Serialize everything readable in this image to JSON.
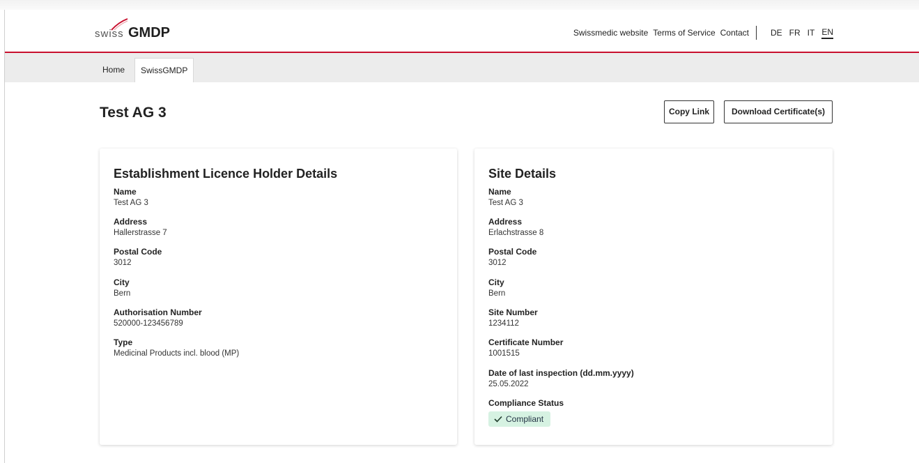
{
  "brand": {
    "logo_prefix": "swiss",
    "logo_main": "GMDP"
  },
  "topnav": {
    "links": [
      "Swissmedic website",
      "Terms of Service",
      "Contact"
    ],
    "languages": [
      "DE",
      "FR",
      "IT",
      "EN"
    ],
    "active_language": "EN"
  },
  "breadcrumb": {
    "home": "Home",
    "current": "SwissGMDP"
  },
  "page": {
    "title": "Test AG 3",
    "copy_link": "Copy Link",
    "download": "Download Certificate(s)"
  },
  "holder": {
    "heading": "Establishment Licence Holder Details",
    "fields": [
      {
        "label": "Name",
        "value": "Test AG 3"
      },
      {
        "label": "Address",
        "value": "Hallerstrasse 7"
      },
      {
        "label": "Postal Code",
        "value": "3012"
      },
      {
        "label": "City",
        "value": "Bern"
      },
      {
        "label": "Authorisation Number",
        "value": "520000-123456789"
      },
      {
        "label": "Type",
        "value": "Medicinal Products incl. blood (MP)"
      }
    ]
  },
  "site": {
    "heading": "Site Details",
    "fields": [
      {
        "label": "Name",
        "value": "Test AG 3"
      },
      {
        "label": "Address",
        "value": "Erlachstrasse 8"
      },
      {
        "label": "Postal Code",
        "value": "3012"
      },
      {
        "label": "City",
        "value": "Bern"
      },
      {
        "label": "Site Number",
        "value": "1234112"
      },
      {
        "label": "Certificate Number",
        "value": "1001515"
      },
      {
        "label": "Date of last inspection (dd.mm.yyyy)",
        "value": "25.05.2022"
      }
    ],
    "compliance_label": "Compliance Status",
    "compliance_value": "Compliant"
  },
  "colors": {
    "accent_red": "#c8102e",
    "badge_green": "#d6f2e2"
  }
}
